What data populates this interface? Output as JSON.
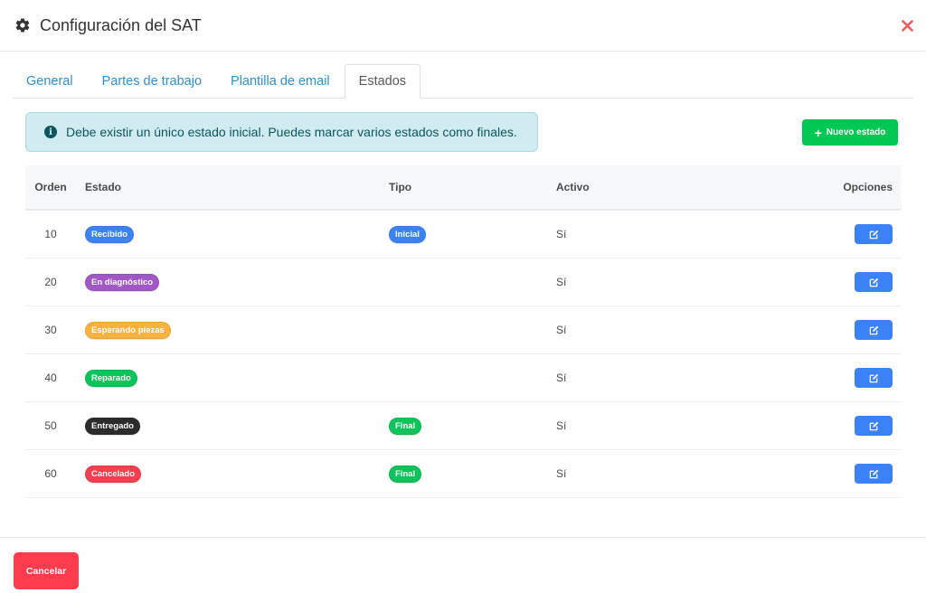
{
  "modal": {
    "title": "Configuración del SAT",
    "close_label": "×"
  },
  "tabs": [
    {
      "label": "General",
      "active": false
    },
    {
      "label": "Partes de trabajo",
      "active": false
    },
    {
      "label": "Plantilla de email",
      "active": false
    },
    {
      "label": "Estados",
      "active": true
    }
  ],
  "alert": {
    "icon": "info-icon",
    "text": "Debe existir un único estado inicial. Puedes marcar varios estados como finales."
  },
  "new_state_button": {
    "label": "Nuevo estado",
    "color": "#00c853"
  },
  "table": {
    "headers": {
      "orden": "Orden",
      "estado": "Estado",
      "tipo": "Tipo",
      "activo": "Activo",
      "opciones": "Opciones"
    },
    "rows": [
      {
        "orden": "10",
        "estado": "Recibido",
        "estado_color": "#3b82f6",
        "tipo": "Inicial",
        "tipo_color": "#3b82f6",
        "activo": "Sí"
      },
      {
        "orden": "20",
        "estado": "En diagnóstico",
        "estado_color": "#a157c6",
        "tipo": "",
        "tipo_color": "",
        "activo": "Sí"
      },
      {
        "orden": "30",
        "estado": "Esperando piezas",
        "estado_color": "#fbb23b",
        "tipo": "",
        "tipo_color": "",
        "activo": "Sí"
      },
      {
        "orden": "40",
        "estado": "Reparado",
        "estado_color": "#0bc45a",
        "tipo": "",
        "tipo_color": "",
        "activo": "Sí"
      },
      {
        "orden": "50",
        "estado": "Entregado",
        "estado_color": "#2b2b2b",
        "tipo": "Final",
        "tipo_color": "#0bc45a",
        "activo": "Sí"
      },
      {
        "orden": "60",
        "estado": "Cancelado",
        "estado_color": "#f43f4e",
        "tipo": "Final",
        "tipo_color": "#0bc45a",
        "activo": "Sí"
      }
    ],
    "edit_icon": "edit-icon",
    "edit_button_color": "#3b82f6"
  },
  "footer": {
    "cancel_label": "Cancelar",
    "cancel_color": "#ff3b4e"
  }
}
